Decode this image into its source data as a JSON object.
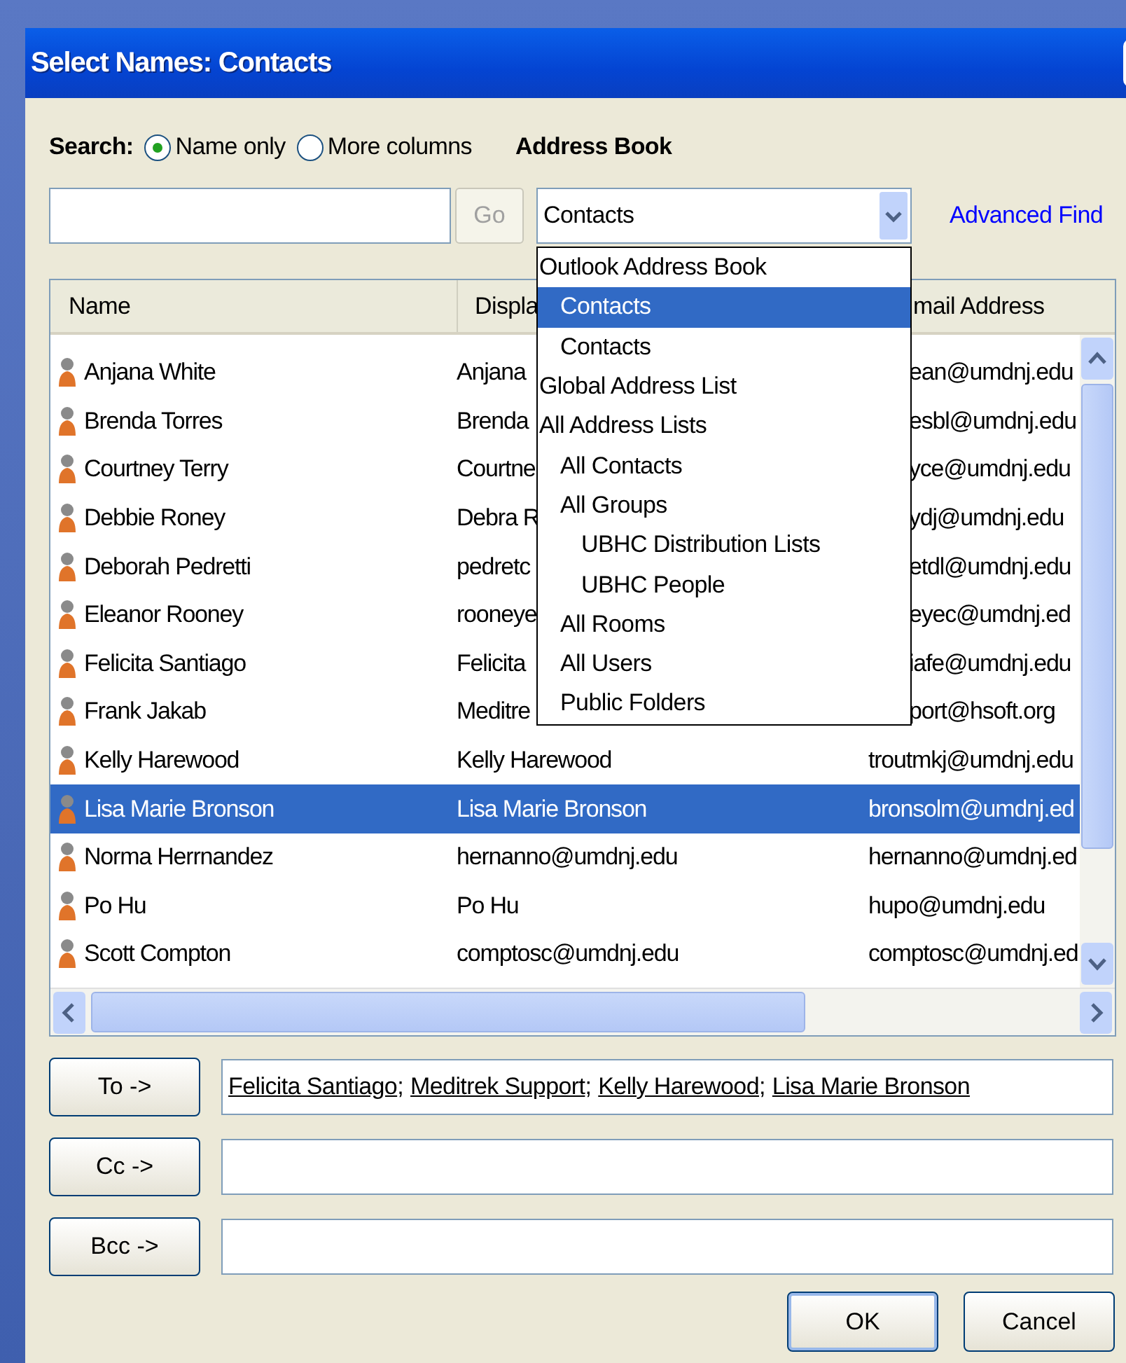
{
  "window": {
    "title": "Select Names: Contacts"
  },
  "search": {
    "label": "Search:",
    "options": [
      {
        "label": "Name only",
        "selected": true
      },
      {
        "label": "More columns",
        "selected": false
      }
    ],
    "go": "Go"
  },
  "address_book": {
    "label": "Address Book",
    "value": "Contacts",
    "advanced_find": "Advanced Find",
    "menu": [
      {
        "label": "Outlook Address Book",
        "selected": false,
        "children": [
          {
            "label": "Contacts",
            "selected": true
          },
          {
            "label": "Contacts",
            "selected": false
          }
        ]
      },
      {
        "label": "Global Address List",
        "selected": false
      },
      {
        "label": "All Address Lists",
        "selected": false,
        "children": [
          {
            "label": "All Contacts",
            "selected": false
          },
          {
            "label": "All Groups",
            "selected": false,
            "children": [
              {
                "label": "UBHC Distribution Lists",
                "selected": false
              },
              {
                "label": "UBHC People",
                "selected": false
              }
            ]
          },
          {
            "label": "All Rooms",
            "selected": false
          },
          {
            "label": "All Users",
            "selected": false
          },
          {
            "label": "Public Folders",
            "selected": false
          }
        ]
      }
    ]
  },
  "table": {
    "columns": [
      {
        "label": "Name",
        "covered": false
      },
      {
        "label": "Displa",
        "covered": false
      },
      {
        "label": "mail Address",
        "covered": true
      }
    ],
    "rows": [
      {
        "name": "Anjana White",
        "display": "Anjana",
        "email": "ean@umdnj.edu",
        "covered": true,
        "selected": false
      },
      {
        "name": "Brenda Torres",
        "display": "Brenda",
        "email": "esbl@umdnj.edu",
        "covered": true,
        "selected": false
      },
      {
        "name": "Courtney Terry",
        "display": "Courtne",
        "email": "yce@umdnj.edu",
        "covered": true,
        "selected": false
      },
      {
        "name": "Debbie Roney",
        "display": "Debra R",
        "email": "ydj@umdnj.edu",
        "covered": true,
        "selected": false
      },
      {
        "name": "Deborah Pedretti",
        "display": "pedretc",
        "email": "etdl@umdnj.edu",
        "covered": true,
        "selected": false
      },
      {
        "name": "Eleanor Rooney",
        "display": "rooneye",
        "email": "eyec@umdnj.ed",
        "covered": true,
        "selected": false
      },
      {
        "name": "Felicita Santiago",
        "display": "Felicita",
        "email": "iafe@umdnj.edu",
        "covered": true,
        "selected": false
      },
      {
        "name": "Frank Jakab",
        "display": "Meditre",
        "email": "port@hsoft.org",
        "covered": true,
        "selected": false
      },
      {
        "name": "Kelly Harewood",
        "display": "Kelly Harewood",
        "email": "troutmkj@umdnj.edu",
        "covered": false,
        "selected": false
      },
      {
        "name": "Lisa Marie Bronson",
        "display": "Lisa Marie Bronson",
        "email": "bronsolm@umdnj.ed",
        "covered": false,
        "selected": true
      },
      {
        "name": "Norma Herrnandez",
        "display": "hernanno@umdnj.edu",
        "email": "hernanno@umdnj.ed",
        "covered": false,
        "selected": false
      },
      {
        "name": "Po Hu",
        "display": "Po Hu",
        "email": "hupo@umdnj.edu",
        "covered": false,
        "selected": false
      },
      {
        "name": "Scott Compton",
        "display": "comptosc@umdnj.edu",
        "email": "comptosc@umdnj.ed",
        "covered": false,
        "selected": false
      }
    ]
  },
  "recipients": [
    {
      "button": "To ->",
      "separator": ";",
      "names": [
        "Felicita Santiago",
        "Meditrek Support",
        "Kelly Harewood",
        "Lisa Marie Bronson"
      ]
    },
    {
      "button": "Cc ->"
    },
    {
      "button": "Bcc ->"
    }
  ],
  "buttons": [
    "OK",
    "Cancel"
  ]
}
